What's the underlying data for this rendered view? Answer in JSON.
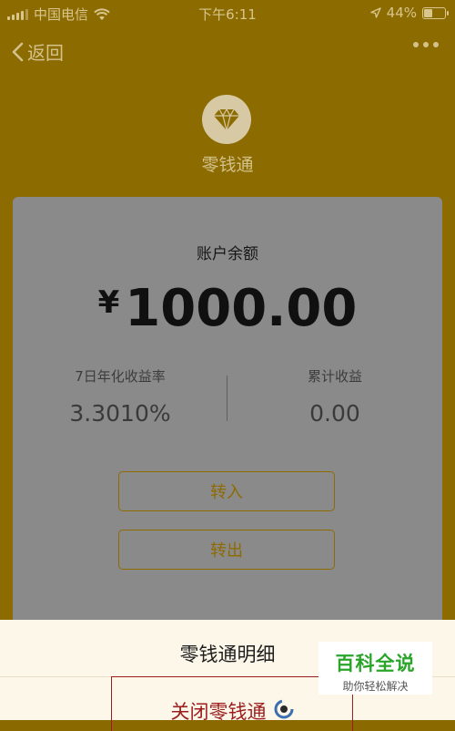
{
  "status_bar": {
    "carrier": "中国电信",
    "time": "下午6:11",
    "battery_percent": "44%",
    "battery_level": 0.44,
    "icons": [
      "signal-icon",
      "wifi-icon",
      "location-icon",
      "battery-icon"
    ]
  },
  "nav": {
    "back_label": "返回",
    "more_icon": "more-icon"
  },
  "header": {
    "product_name": "零钱通",
    "logo_icon": "diamond-icon"
  },
  "account": {
    "balance_label": "账户余额",
    "currency_symbol": "¥",
    "balance": "1000.00",
    "yield_label": "7日年化收益率",
    "yield_value": "3.3010%",
    "earnings_label": "累计收益",
    "earnings_value": "0.00"
  },
  "actions": {
    "transfer_in": "转入",
    "transfer_out": "转出"
  },
  "sheet": {
    "title": "零钱通明细",
    "close_label": "关闭零钱通",
    "close_icon": "loading-icon"
  },
  "watermark": {
    "title": "百科全说",
    "subtitle": "助你轻松解决"
  },
  "colors": {
    "header_bg": "#8c6b00",
    "card_bg": "#8a8a8a",
    "accent_gold": "#8e6b00",
    "danger_red": "#9b1d1d",
    "sheet_bg": "#fdf7ea"
  }
}
